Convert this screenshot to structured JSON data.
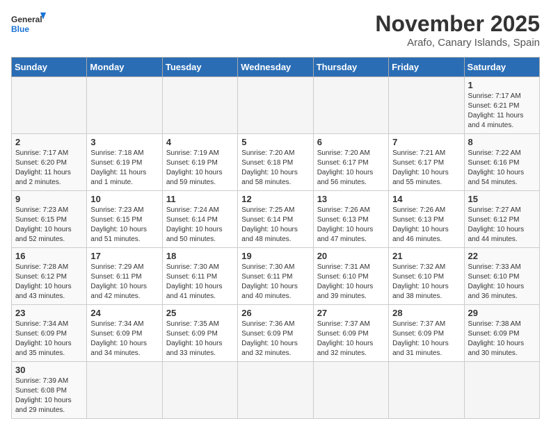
{
  "header": {
    "logo_general": "General",
    "logo_blue": "Blue",
    "month": "November 2025",
    "location": "Arafo, Canary Islands, Spain"
  },
  "days_of_week": [
    "Sunday",
    "Monday",
    "Tuesday",
    "Wednesday",
    "Thursday",
    "Friday",
    "Saturday"
  ],
  "weeks": [
    [
      {
        "day": "",
        "info": ""
      },
      {
        "day": "",
        "info": ""
      },
      {
        "day": "",
        "info": ""
      },
      {
        "day": "",
        "info": ""
      },
      {
        "day": "",
        "info": ""
      },
      {
        "day": "",
        "info": ""
      },
      {
        "day": "1",
        "info": "Sunrise: 7:17 AM\nSunset: 6:21 PM\nDaylight: 11 hours and 4 minutes."
      }
    ],
    [
      {
        "day": "2",
        "info": "Sunrise: 7:17 AM\nSunset: 6:20 PM\nDaylight: 11 hours and 2 minutes."
      },
      {
        "day": "3",
        "info": "Sunrise: 7:18 AM\nSunset: 6:19 PM\nDaylight: 11 hours and 1 minute."
      },
      {
        "day": "4",
        "info": "Sunrise: 7:19 AM\nSunset: 6:19 PM\nDaylight: 10 hours and 59 minutes."
      },
      {
        "day": "5",
        "info": "Sunrise: 7:20 AM\nSunset: 6:18 PM\nDaylight: 10 hours and 58 minutes."
      },
      {
        "day": "6",
        "info": "Sunrise: 7:20 AM\nSunset: 6:17 PM\nDaylight: 10 hours and 56 minutes."
      },
      {
        "day": "7",
        "info": "Sunrise: 7:21 AM\nSunset: 6:17 PM\nDaylight: 10 hours and 55 minutes."
      },
      {
        "day": "8",
        "info": "Sunrise: 7:22 AM\nSunset: 6:16 PM\nDaylight: 10 hours and 54 minutes."
      }
    ],
    [
      {
        "day": "9",
        "info": "Sunrise: 7:23 AM\nSunset: 6:15 PM\nDaylight: 10 hours and 52 minutes."
      },
      {
        "day": "10",
        "info": "Sunrise: 7:23 AM\nSunset: 6:15 PM\nDaylight: 10 hours and 51 minutes."
      },
      {
        "day": "11",
        "info": "Sunrise: 7:24 AM\nSunset: 6:14 PM\nDaylight: 10 hours and 50 minutes."
      },
      {
        "day": "12",
        "info": "Sunrise: 7:25 AM\nSunset: 6:14 PM\nDaylight: 10 hours and 48 minutes."
      },
      {
        "day": "13",
        "info": "Sunrise: 7:26 AM\nSunset: 6:13 PM\nDaylight: 10 hours and 47 minutes."
      },
      {
        "day": "14",
        "info": "Sunrise: 7:26 AM\nSunset: 6:13 PM\nDaylight: 10 hours and 46 minutes."
      },
      {
        "day": "15",
        "info": "Sunrise: 7:27 AM\nSunset: 6:12 PM\nDaylight: 10 hours and 44 minutes."
      }
    ],
    [
      {
        "day": "16",
        "info": "Sunrise: 7:28 AM\nSunset: 6:12 PM\nDaylight: 10 hours and 43 minutes."
      },
      {
        "day": "17",
        "info": "Sunrise: 7:29 AM\nSunset: 6:11 PM\nDaylight: 10 hours and 42 minutes."
      },
      {
        "day": "18",
        "info": "Sunrise: 7:30 AM\nSunset: 6:11 PM\nDaylight: 10 hours and 41 minutes."
      },
      {
        "day": "19",
        "info": "Sunrise: 7:30 AM\nSunset: 6:11 PM\nDaylight: 10 hours and 40 minutes."
      },
      {
        "day": "20",
        "info": "Sunrise: 7:31 AM\nSunset: 6:10 PM\nDaylight: 10 hours and 39 minutes."
      },
      {
        "day": "21",
        "info": "Sunrise: 7:32 AM\nSunset: 6:10 PM\nDaylight: 10 hours and 38 minutes."
      },
      {
        "day": "22",
        "info": "Sunrise: 7:33 AM\nSunset: 6:10 PM\nDaylight: 10 hours and 36 minutes."
      }
    ],
    [
      {
        "day": "23",
        "info": "Sunrise: 7:34 AM\nSunset: 6:09 PM\nDaylight: 10 hours and 35 minutes."
      },
      {
        "day": "24",
        "info": "Sunrise: 7:34 AM\nSunset: 6:09 PM\nDaylight: 10 hours and 34 minutes."
      },
      {
        "day": "25",
        "info": "Sunrise: 7:35 AM\nSunset: 6:09 PM\nDaylight: 10 hours and 33 minutes."
      },
      {
        "day": "26",
        "info": "Sunrise: 7:36 AM\nSunset: 6:09 PM\nDaylight: 10 hours and 32 minutes."
      },
      {
        "day": "27",
        "info": "Sunrise: 7:37 AM\nSunset: 6:09 PM\nDaylight: 10 hours and 32 minutes."
      },
      {
        "day": "28",
        "info": "Sunrise: 7:37 AM\nSunset: 6:09 PM\nDaylight: 10 hours and 31 minutes."
      },
      {
        "day": "29",
        "info": "Sunrise: 7:38 AM\nSunset: 6:09 PM\nDaylight: 10 hours and 30 minutes."
      }
    ],
    [
      {
        "day": "30",
        "info": "Sunrise: 7:39 AM\nSunset: 6:08 PM\nDaylight: 10 hours and 29 minutes."
      },
      {
        "day": "",
        "info": ""
      },
      {
        "day": "",
        "info": ""
      },
      {
        "day": "",
        "info": ""
      },
      {
        "day": "",
        "info": ""
      },
      {
        "day": "",
        "info": ""
      },
      {
        "day": "",
        "info": ""
      }
    ]
  ]
}
